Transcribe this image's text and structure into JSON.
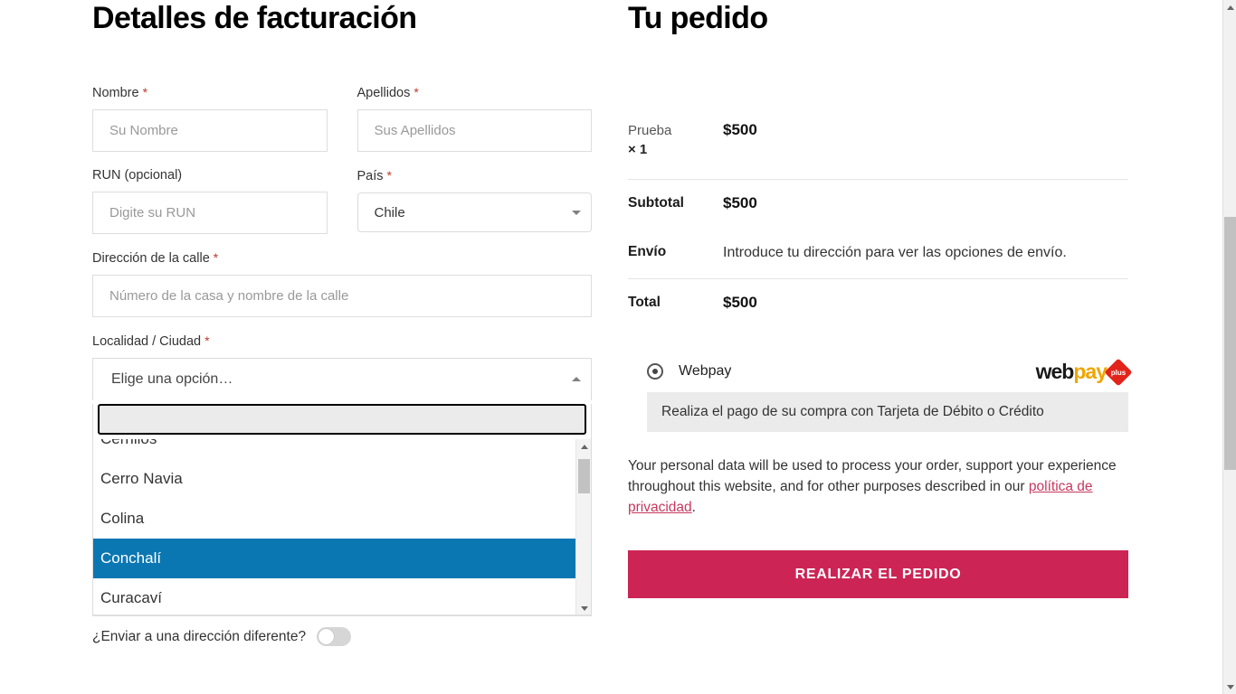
{
  "billing": {
    "title": "Detalles de facturación",
    "fields": [
      {
        "label": "Nombre",
        "required_mark": "*",
        "placeholder": "Su Nombre",
        "value": ""
      },
      {
        "label": "Apellidos",
        "required_mark": "*",
        "placeholder": "Sus Apellidos",
        "value": ""
      },
      {
        "label": "RUN (opcional)",
        "required_mark": "",
        "placeholder": "Digite su RUN",
        "value": ""
      },
      {
        "label": "País",
        "required_mark": "*",
        "value": "Chile"
      },
      {
        "label": "Dirección de la calle",
        "required_mark": "*",
        "placeholder": "Número de la casa y nombre de la calle",
        "value": ""
      },
      {
        "label": "Localidad / Ciudad",
        "required_mark": "*",
        "value": "Elige una opción…"
      }
    ],
    "city_dropdown": {
      "selected_display": "Elige una opción…",
      "search_value": "",
      "search_placeholder": "",
      "options": [
        {
          "label": "Cerrillos",
          "selected": false
        },
        {
          "label": "Cerro Navia",
          "selected": false
        },
        {
          "label": "Colina",
          "selected": false
        },
        {
          "label": "Conchalí",
          "selected": true
        },
        {
          "label": "Curacaví",
          "selected": false
        }
      ]
    },
    "ship_different_label": "¿Enviar a una dirección diferente?",
    "ship_different_on": false
  },
  "order": {
    "title": "Tu pedido",
    "line_items": [
      {
        "name": "Prueba",
        "quantity": "× 1",
        "price": "$500"
      }
    ],
    "totals": [
      {
        "label": "Subtotal",
        "value": "$500",
        "is_text": false
      },
      {
        "label": "Envío",
        "value": "Introduce tu dirección para ver las opciones de envío.",
        "is_text": true
      },
      {
        "label": "Total",
        "value": "$500",
        "is_text": false
      }
    ],
    "payment": {
      "method_label": "Webpay",
      "method_selected": true,
      "logo": {
        "part1": "web",
        "part2": "pay",
        "badge": "plus"
      },
      "description": "Realiza el pago de su compra con Tarjeta de Débito o Crédito"
    },
    "privacy_text_before": "Your personal data will be used to process your order, support your experience throughout this website, and for other purposes described in our ",
    "privacy_link": "política de privacidad",
    "privacy_text_after": ".",
    "place_order_label": "REALIZAR EL PEDIDO"
  },
  "colors": {
    "accent_button": "#cc2455",
    "highlight_option": "#0b77b2",
    "link": "#c7385f",
    "webpay_orange": "#f0a500",
    "webpay_red": "#e2231a",
    "required_star": "#c0392b"
  }
}
